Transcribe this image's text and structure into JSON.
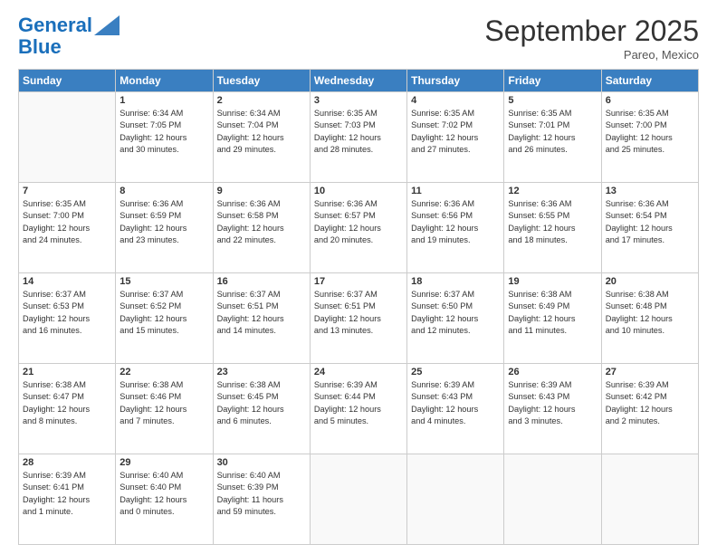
{
  "logo": {
    "line1": "General",
    "line2": "Blue"
  },
  "header": {
    "month": "September 2025",
    "location": "Pareo, Mexico"
  },
  "days_of_week": [
    "Sunday",
    "Monday",
    "Tuesday",
    "Wednesday",
    "Thursday",
    "Friday",
    "Saturday"
  ],
  "weeks": [
    [
      {
        "day": "",
        "info": ""
      },
      {
        "day": "1",
        "info": "Sunrise: 6:34 AM\nSunset: 7:05 PM\nDaylight: 12 hours\nand 30 minutes."
      },
      {
        "day": "2",
        "info": "Sunrise: 6:34 AM\nSunset: 7:04 PM\nDaylight: 12 hours\nand 29 minutes."
      },
      {
        "day": "3",
        "info": "Sunrise: 6:35 AM\nSunset: 7:03 PM\nDaylight: 12 hours\nand 28 minutes."
      },
      {
        "day": "4",
        "info": "Sunrise: 6:35 AM\nSunset: 7:02 PM\nDaylight: 12 hours\nand 27 minutes."
      },
      {
        "day": "5",
        "info": "Sunrise: 6:35 AM\nSunset: 7:01 PM\nDaylight: 12 hours\nand 26 minutes."
      },
      {
        "day": "6",
        "info": "Sunrise: 6:35 AM\nSunset: 7:00 PM\nDaylight: 12 hours\nand 25 minutes."
      }
    ],
    [
      {
        "day": "7",
        "info": "Sunrise: 6:35 AM\nSunset: 7:00 PM\nDaylight: 12 hours\nand 24 minutes."
      },
      {
        "day": "8",
        "info": "Sunrise: 6:36 AM\nSunset: 6:59 PM\nDaylight: 12 hours\nand 23 minutes."
      },
      {
        "day": "9",
        "info": "Sunrise: 6:36 AM\nSunset: 6:58 PM\nDaylight: 12 hours\nand 22 minutes."
      },
      {
        "day": "10",
        "info": "Sunrise: 6:36 AM\nSunset: 6:57 PM\nDaylight: 12 hours\nand 20 minutes."
      },
      {
        "day": "11",
        "info": "Sunrise: 6:36 AM\nSunset: 6:56 PM\nDaylight: 12 hours\nand 19 minutes."
      },
      {
        "day": "12",
        "info": "Sunrise: 6:36 AM\nSunset: 6:55 PM\nDaylight: 12 hours\nand 18 minutes."
      },
      {
        "day": "13",
        "info": "Sunrise: 6:36 AM\nSunset: 6:54 PM\nDaylight: 12 hours\nand 17 minutes."
      }
    ],
    [
      {
        "day": "14",
        "info": "Sunrise: 6:37 AM\nSunset: 6:53 PM\nDaylight: 12 hours\nand 16 minutes."
      },
      {
        "day": "15",
        "info": "Sunrise: 6:37 AM\nSunset: 6:52 PM\nDaylight: 12 hours\nand 15 minutes."
      },
      {
        "day": "16",
        "info": "Sunrise: 6:37 AM\nSunset: 6:51 PM\nDaylight: 12 hours\nand 14 minutes."
      },
      {
        "day": "17",
        "info": "Sunrise: 6:37 AM\nSunset: 6:51 PM\nDaylight: 12 hours\nand 13 minutes."
      },
      {
        "day": "18",
        "info": "Sunrise: 6:37 AM\nSunset: 6:50 PM\nDaylight: 12 hours\nand 12 minutes."
      },
      {
        "day": "19",
        "info": "Sunrise: 6:38 AM\nSunset: 6:49 PM\nDaylight: 12 hours\nand 11 minutes."
      },
      {
        "day": "20",
        "info": "Sunrise: 6:38 AM\nSunset: 6:48 PM\nDaylight: 12 hours\nand 10 minutes."
      }
    ],
    [
      {
        "day": "21",
        "info": "Sunrise: 6:38 AM\nSunset: 6:47 PM\nDaylight: 12 hours\nand 8 minutes."
      },
      {
        "day": "22",
        "info": "Sunrise: 6:38 AM\nSunset: 6:46 PM\nDaylight: 12 hours\nand 7 minutes."
      },
      {
        "day": "23",
        "info": "Sunrise: 6:38 AM\nSunset: 6:45 PM\nDaylight: 12 hours\nand 6 minutes."
      },
      {
        "day": "24",
        "info": "Sunrise: 6:39 AM\nSunset: 6:44 PM\nDaylight: 12 hours\nand 5 minutes."
      },
      {
        "day": "25",
        "info": "Sunrise: 6:39 AM\nSunset: 6:43 PM\nDaylight: 12 hours\nand 4 minutes."
      },
      {
        "day": "26",
        "info": "Sunrise: 6:39 AM\nSunset: 6:43 PM\nDaylight: 12 hours\nand 3 minutes."
      },
      {
        "day": "27",
        "info": "Sunrise: 6:39 AM\nSunset: 6:42 PM\nDaylight: 12 hours\nand 2 minutes."
      }
    ],
    [
      {
        "day": "28",
        "info": "Sunrise: 6:39 AM\nSunset: 6:41 PM\nDaylight: 12 hours\nand 1 minute."
      },
      {
        "day": "29",
        "info": "Sunrise: 6:40 AM\nSunset: 6:40 PM\nDaylight: 12 hours\nand 0 minutes."
      },
      {
        "day": "30",
        "info": "Sunrise: 6:40 AM\nSunset: 6:39 PM\nDaylight: 11 hours\nand 59 minutes."
      },
      {
        "day": "",
        "info": ""
      },
      {
        "day": "",
        "info": ""
      },
      {
        "day": "",
        "info": ""
      },
      {
        "day": "",
        "info": ""
      }
    ]
  ]
}
